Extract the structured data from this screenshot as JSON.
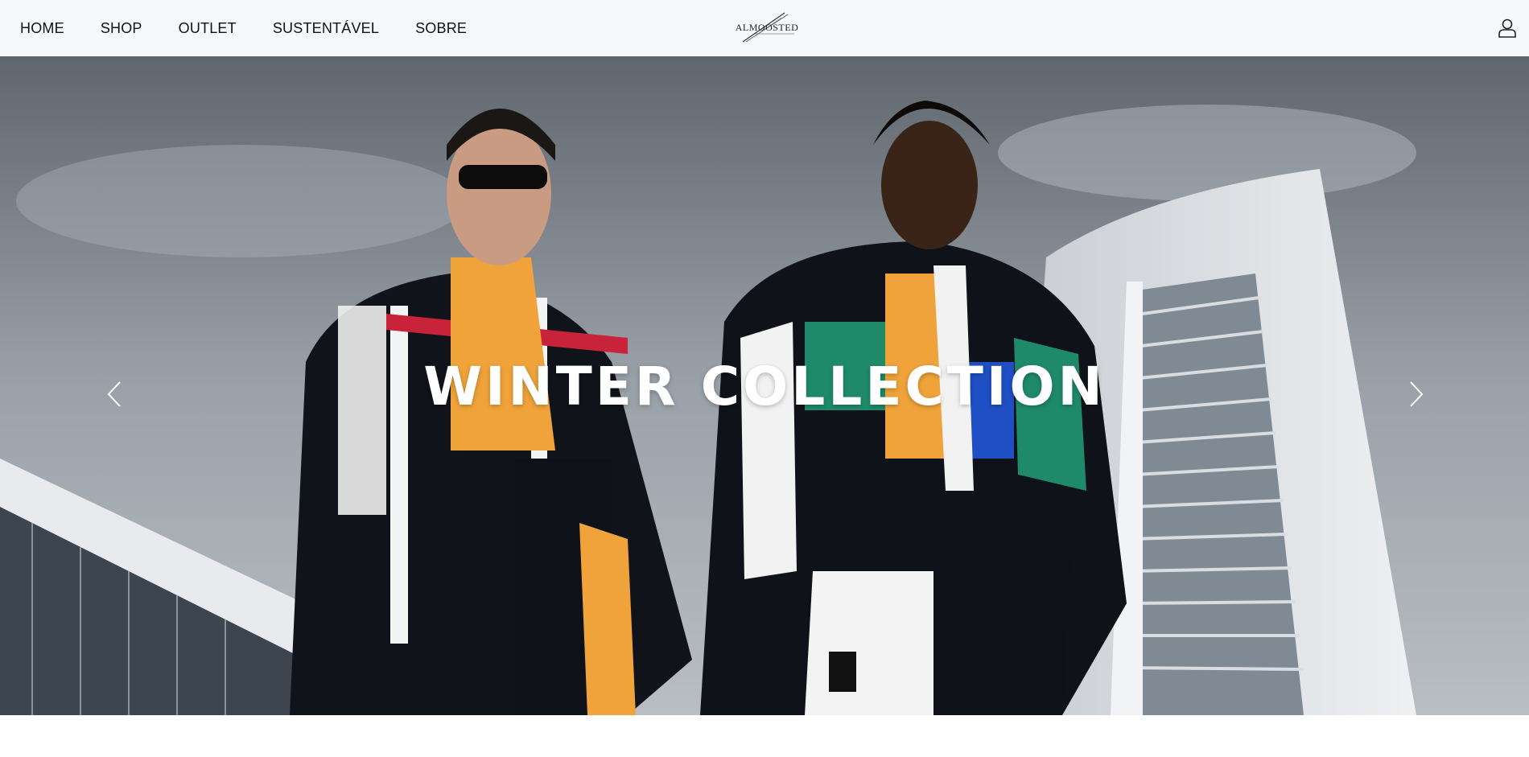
{
  "nav": {
    "items": [
      {
        "label": "HOME"
      },
      {
        "label": "SHOP"
      },
      {
        "label": "OUTLET"
      },
      {
        "label": "SUSTENTÁVEL"
      },
      {
        "label": "SOBRE"
      }
    ],
    "logo_text": "ALMOOSTED",
    "account_icon": "user-icon"
  },
  "hero": {
    "title": "WINTER COLLECTION",
    "prev_icon": "chevron-left-icon",
    "next_icon": "chevron-right-icon"
  },
  "colors": {
    "navbar_bg": "#f7f8fa",
    "text": "#111111",
    "hero_text": "#ffffff"
  }
}
